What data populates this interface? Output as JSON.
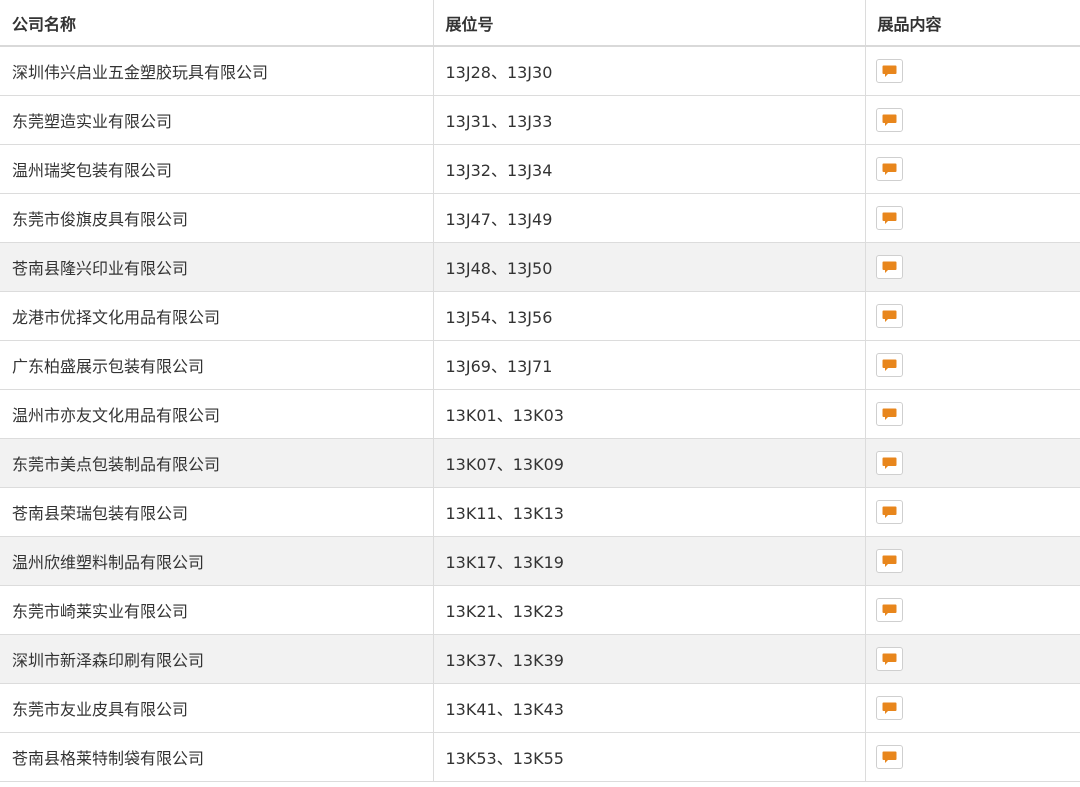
{
  "table": {
    "headers": [
      "公司名称",
      "展位号",
      "展品内容"
    ],
    "action_icon": "chat-bubble-icon",
    "accent_color": "#e8861c",
    "rows": [
      {
        "company": "深圳伟兴启业五金塑胶玩具有限公司",
        "booth": "13J28、13J30",
        "shaded": false
      },
      {
        "company": "东莞塑造实业有限公司",
        "booth": "13J31、13J33",
        "shaded": false
      },
      {
        "company": "温州瑞奖包装有限公司",
        "booth": "13J32、13J34",
        "shaded": false
      },
      {
        "company": "东莞市俊旗皮具有限公司",
        "booth": "13J47、13J49",
        "shaded": false
      },
      {
        "company": "苍南县隆兴印业有限公司",
        "booth": "13J48、13J50",
        "shaded": true
      },
      {
        "company": "龙港市优择文化用品有限公司",
        "booth": "13J54、13J56",
        "shaded": false
      },
      {
        "company": "广东柏盛展示包装有限公司",
        "booth": "13J69、13J71",
        "shaded": false
      },
      {
        "company": "温州市亦友文化用品有限公司",
        "booth": "13K01、13K03",
        "shaded": false
      },
      {
        "company": "东莞市美点包装制品有限公司",
        "booth": "13K07、13K09",
        "shaded": true
      },
      {
        "company": "苍南县荣瑞包装有限公司",
        "booth": "13K11、13K13",
        "shaded": false
      },
      {
        "company": "温州欣维塑料制品有限公司",
        "booth": "13K17、13K19",
        "shaded": true
      },
      {
        "company": "东莞市崎莱实业有限公司",
        "booth": "13K21、13K23",
        "shaded": false
      },
      {
        "company": "深圳市新泽森印刷有限公司",
        "booth": "13K37、13K39",
        "shaded": true
      },
      {
        "company": "东莞市友业皮具有限公司",
        "booth": "13K41、13K43",
        "shaded": false
      },
      {
        "company": "苍南县格莱特制袋有限公司",
        "booth": "13K53、13K55",
        "shaded": false
      }
    ]
  }
}
